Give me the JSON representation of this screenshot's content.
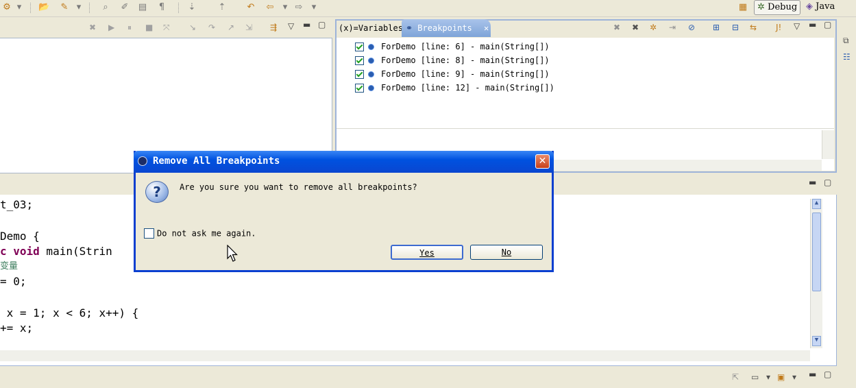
{
  "perspectives": {
    "debug": "Debug",
    "java": "Java"
  },
  "tabs": {
    "variables": "Variables",
    "variables_prefix": "(x)=",
    "breakpoints": "Breakpoints"
  },
  "breakpoints": [
    {
      "label": "ForDemo [line: 6] - main(String[])",
      "checked": true
    },
    {
      "label": "ForDemo [line: 8] - main(String[])",
      "checked": true
    },
    {
      "label": "ForDemo [line: 9] - main(String[])",
      "checked": true
    },
    {
      "label": "ForDemo [line: 12] - main(String[])",
      "checked": true
    }
  ],
  "code_lines": [
    "t_03;",
    "",
    "Demo {",
    "c void main(Strin",
    "变量",
    "= 0;",
    "",
    " x = 1; x < 6; x++) {",
    "+= x;"
  ],
  "dialog": {
    "title": "Remove All Breakpoints",
    "message": "Are you sure you want to remove all breakpoints?",
    "checkbox_label": "Do not ask me again.",
    "yes": "Yes",
    "no": "No"
  },
  "colors": {
    "title_bar": "#0a46d0",
    "tab_active": "#7ea4d8",
    "background": "#ece9d8"
  }
}
